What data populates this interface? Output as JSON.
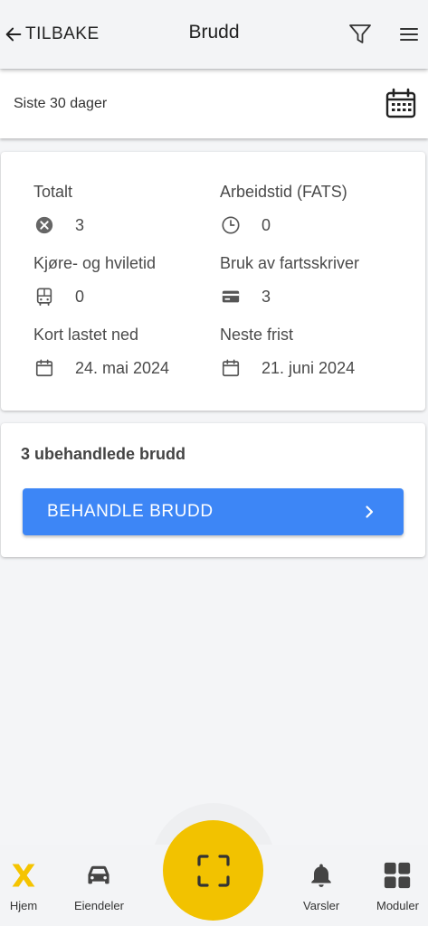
{
  "header": {
    "back_label": "TILBAKE",
    "title": "Brudd"
  },
  "period": {
    "label": "Siste 30 dager"
  },
  "summary": {
    "total": {
      "label": "Totalt",
      "value": "3",
      "icon": "cancel-circle-icon"
    },
    "working_time": {
      "label": "Arbeidstid (FATS)",
      "value": "0",
      "icon": "clock-icon"
    },
    "driving_rest": {
      "label": "Kjøre- og hviletid",
      "value": "0",
      "icon": "bus-icon"
    },
    "tachograph_use": {
      "label": "Bruk av fartsskriver",
      "value": "3",
      "icon": "card-icon"
    },
    "card_downloaded": {
      "label": "Kort lastet ned",
      "value": "24. mai 2024",
      "icon": "calendar-icon"
    },
    "next_deadline": {
      "label": "Neste frist",
      "value": "21. juni 2024",
      "icon": "calendar-icon"
    }
  },
  "violations": {
    "count_text": "3 ubehandlede brudd",
    "button_label": "BEHANDLE BRUDD"
  },
  "nav": {
    "home": "Hjem",
    "assets": "Eiendeler",
    "alerts": "Varsler",
    "modules": "Moduler"
  },
  "colors": {
    "accent_blue": "#3d86f6",
    "accent_yellow": "#f2c200",
    "logo_yellow": "#f5c400"
  }
}
